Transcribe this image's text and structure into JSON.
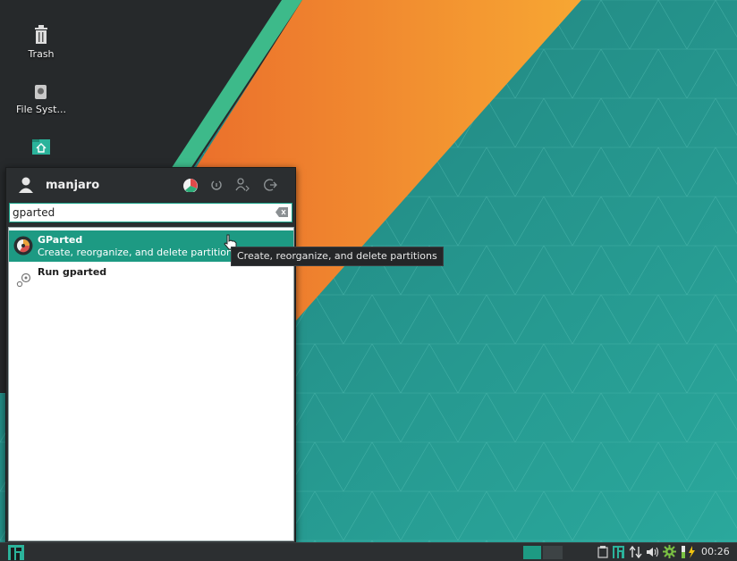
{
  "desktop": {
    "icons": [
      {
        "label": "Trash",
        "icon": "trash-icon"
      },
      {
        "label": "File Syst...",
        "icon": "drive-icon"
      },
      {
        "label": "",
        "icon": "home-folder-icon"
      }
    ]
  },
  "menu": {
    "username": "manjaro",
    "header_buttons": [
      "settings-icon",
      "lock-icon",
      "switch-user-icon",
      "logout-icon"
    ],
    "search": {
      "value": "gparted",
      "placeholder": ""
    },
    "results": [
      {
        "title": "GParted",
        "description": "Create, reorganize, and delete partitions",
        "icon": "gparted-icon",
        "selected": true
      },
      {
        "title": "Run gparted",
        "description": "",
        "icon": "run-command-icon",
        "selected": false
      }
    ],
    "tooltip": "Create, reorganize, and delete partitions"
  },
  "panel": {
    "menu_button_icon": "manjaro-logo-icon",
    "workspaces": 2,
    "active_workspace": 1,
    "tray_icons": [
      "clipboard-icon",
      "manjaro-tray-icon",
      "network-icon",
      "volume-icon",
      "update-icon",
      "power-icon"
    ],
    "clock": "00:26"
  },
  "colors": {
    "accent": "#1d9a83",
    "wallpaper_teal": "#269a90",
    "stripe_orange": "#f7931e",
    "panel_bg": "#2c2f31"
  }
}
